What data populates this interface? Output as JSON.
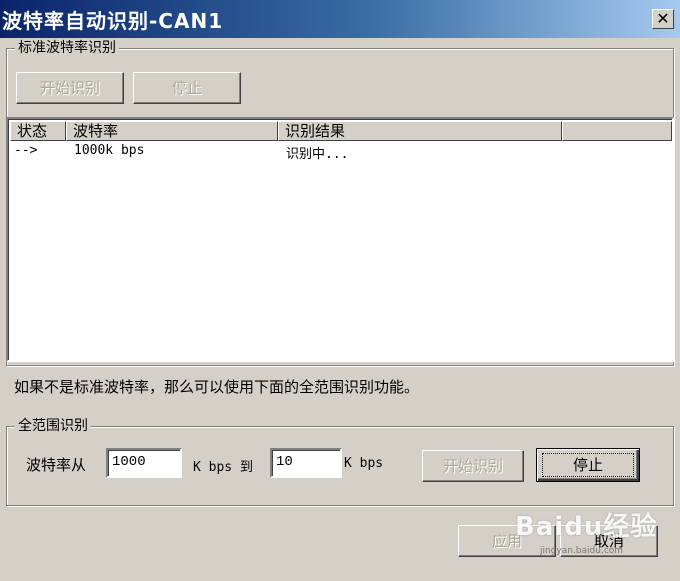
{
  "window": {
    "title": "波特率自动识别-CAN1",
    "close_symbol": "✕"
  },
  "standard_group": {
    "label": "标准波特率识别",
    "start_button": "开始识别",
    "stop_button": "停止",
    "list": {
      "columns": [
        "状态",
        "波特率",
        "识别结果"
      ],
      "rows": [
        {
          "status": "-->",
          "baud": "1000k bps",
          "result": "识别中..."
        }
      ]
    }
  },
  "info_text": "如果不是标准波特率，那么可以使用下面的全范围识别功能。",
  "full_range_group": {
    "label": "全范围识别",
    "from_label": "波特率从",
    "from_value": "1000",
    "unit_to": "K bps 到",
    "to_value": "10",
    "unit": "K bps",
    "start_button": "开始识别",
    "stop_button": "停止"
  },
  "footer": {
    "apply_button": "应用",
    "cancel_button": "取消"
  },
  "watermark": {
    "brand": "Baidu经验",
    "url": "jingyan.baidu.com"
  }
}
